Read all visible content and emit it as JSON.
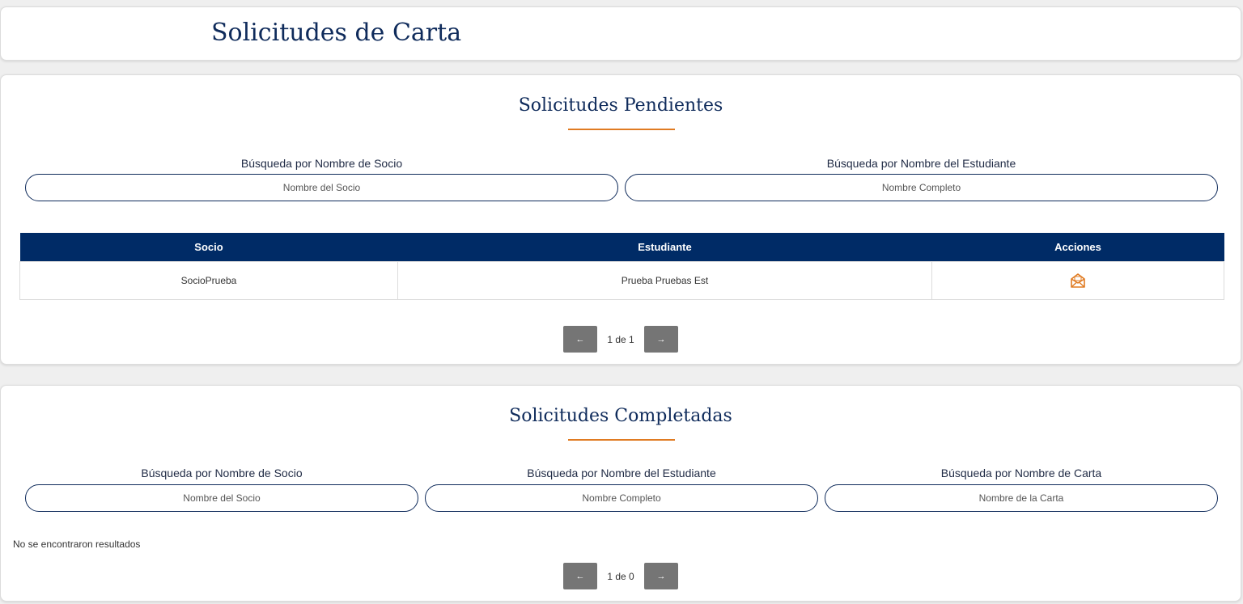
{
  "header": {
    "title": "Solicitudes de Carta"
  },
  "pending": {
    "title": "Solicitudes Pendientes",
    "search_socio": {
      "label": "Búsqueda por Nombre de Socio",
      "placeholder": "Nombre del Socio"
    },
    "search_estudiante": {
      "label": "Búsqueda por Nombre del Estudiante",
      "placeholder": "Nombre Completo"
    },
    "columns": [
      "Socio",
      "Estudiante",
      "Acciones"
    ],
    "rows": [
      {
        "socio": "SocioPrueba",
        "estudiante": "Prueba Pruebas Est",
        "action_icon": "open-envelope-icon"
      }
    ],
    "pagination": {
      "prev": "←",
      "text": "1 de 1",
      "next": "→"
    }
  },
  "completed": {
    "title": "Solicitudes Completadas",
    "search_socio": {
      "label": "Búsqueda por Nombre de Socio",
      "placeholder": "Nombre del Socio"
    },
    "search_estudiante": {
      "label": "Búsqueda por Nombre del Estudiante",
      "placeholder": "Nombre Completo"
    },
    "search_carta": {
      "label": "Búsqueda por Nombre de Carta",
      "placeholder": "Nombre de la Carta"
    },
    "empty_message": "No se encontraron resultados",
    "pagination": {
      "prev": "←",
      "text": "1 de 0",
      "next": "→"
    }
  },
  "colors": {
    "primary": "#002b66",
    "accent": "#e07b22",
    "pager": "#757575"
  }
}
